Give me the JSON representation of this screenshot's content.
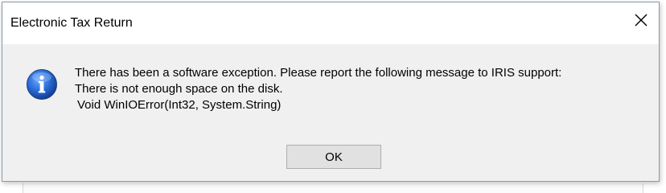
{
  "dialog": {
    "title": "Electronic Tax Return",
    "close_icon": "close-icon",
    "icon": "info-icon",
    "message_lines": [
      "There has been a software exception. Please report the following message to IRIS support:",
      "There is not enough space on the disk.",
      "Void WinIOError(Int32, System.String)"
    ],
    "ok_label": "OK"
  },
  "colors": {
    "title_bar_bg": "#ffffff",
    "dialog_bg": "#f0f0f0",
    "button_bg": "#e1e1e1",
    "button_border": "#adadad",
    "info_icon_blue": "#1f5fbf"
  }
}
